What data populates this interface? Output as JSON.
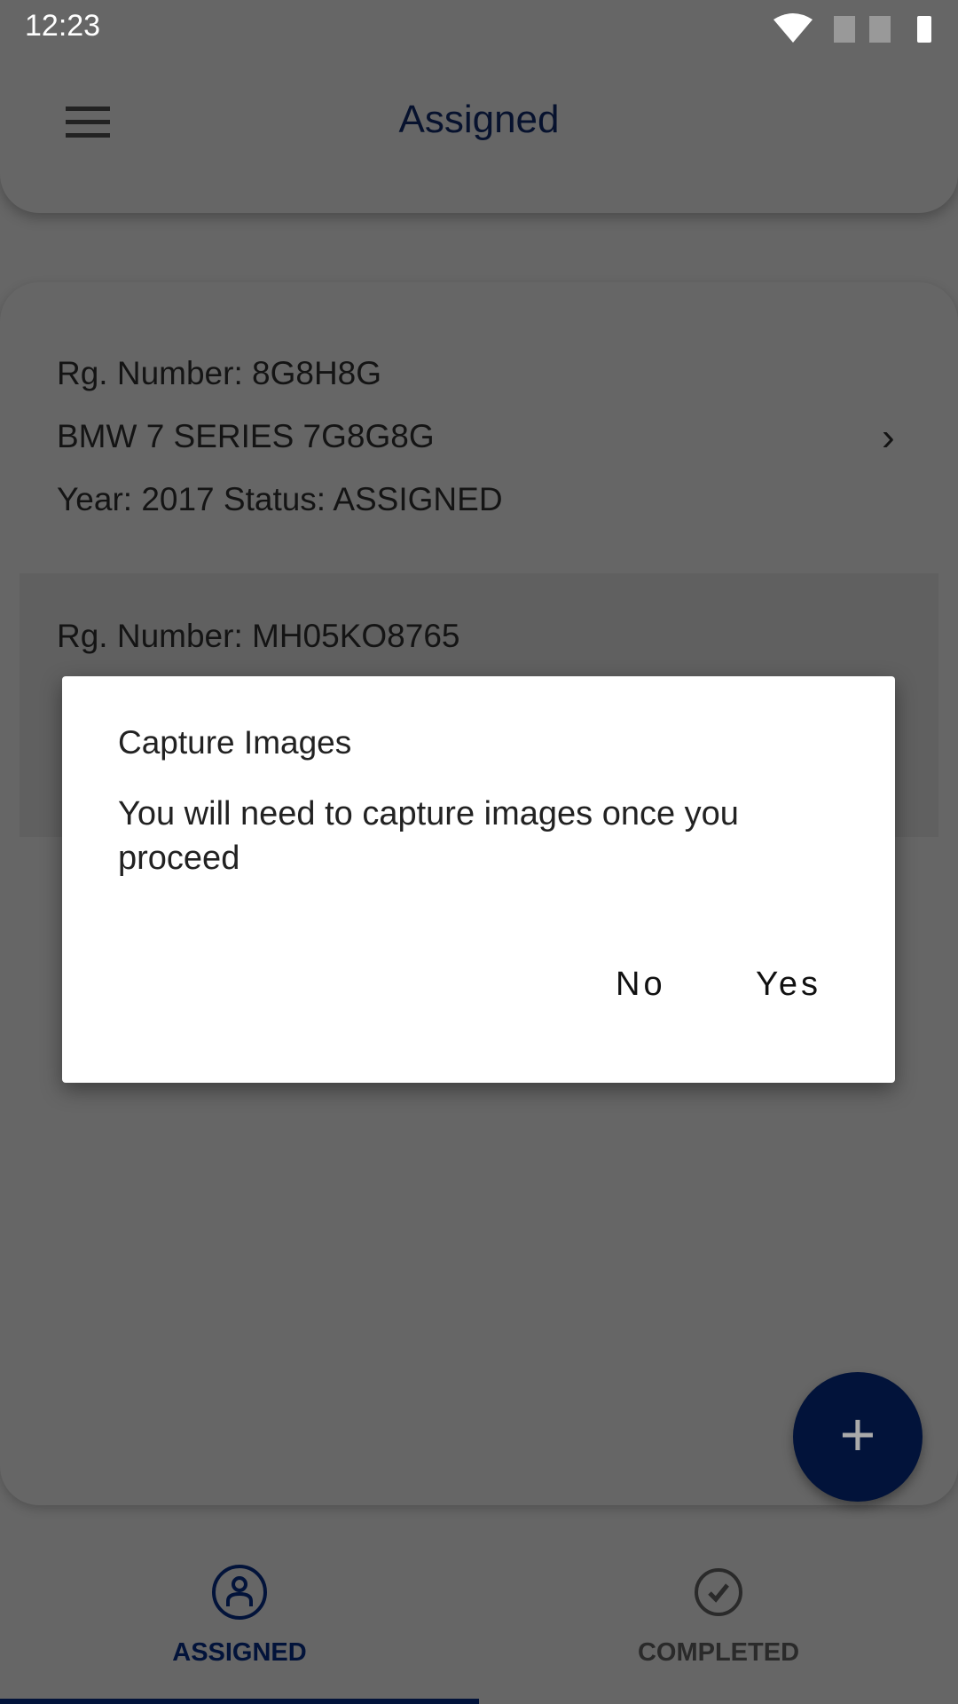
{
  "status_bar": {
    "time": "12:23",
    "icons": [
      "wifi-icon",
      "no-sim-icon",
      "no-sim-icon",
      "battery-icon"
    ]
  },
  "header": {
    "title": "Assigned",
    "menu_icon": "hamburger-menu-icon"
  },
  "list": {
    "items": [
      {
        "reg": "Rg. Number: 8G8H8G",
        "vehicle": "BMW  7 SERIES  7G8G8G",
        "meta": "Year: 2017  Status: ASSIGNED"
      },
      {
        "reg": "Rg. Number: MH05KO8765"
      }
    ]
  },
  "fab": {
    "label": "+"
  },
  "bottom_nav": {
    "tabs": [
      {
        "label": "ASSIGNED",
        "icon": "user-circle-icon",
        "active": true
      },
      {
        "label": "COMPLETED",
        "icon": "check-circle-icon",
        "active": false
      }
    ],
    "active_color": "#03174a",
    "inactive_color": "#333333"
  },
  "dialog": {
    "title": "Capture Images",
    "message": "You will need to capture images once you proceed",
    "negative": "No",
    "positive": "Yes"
  }
}
